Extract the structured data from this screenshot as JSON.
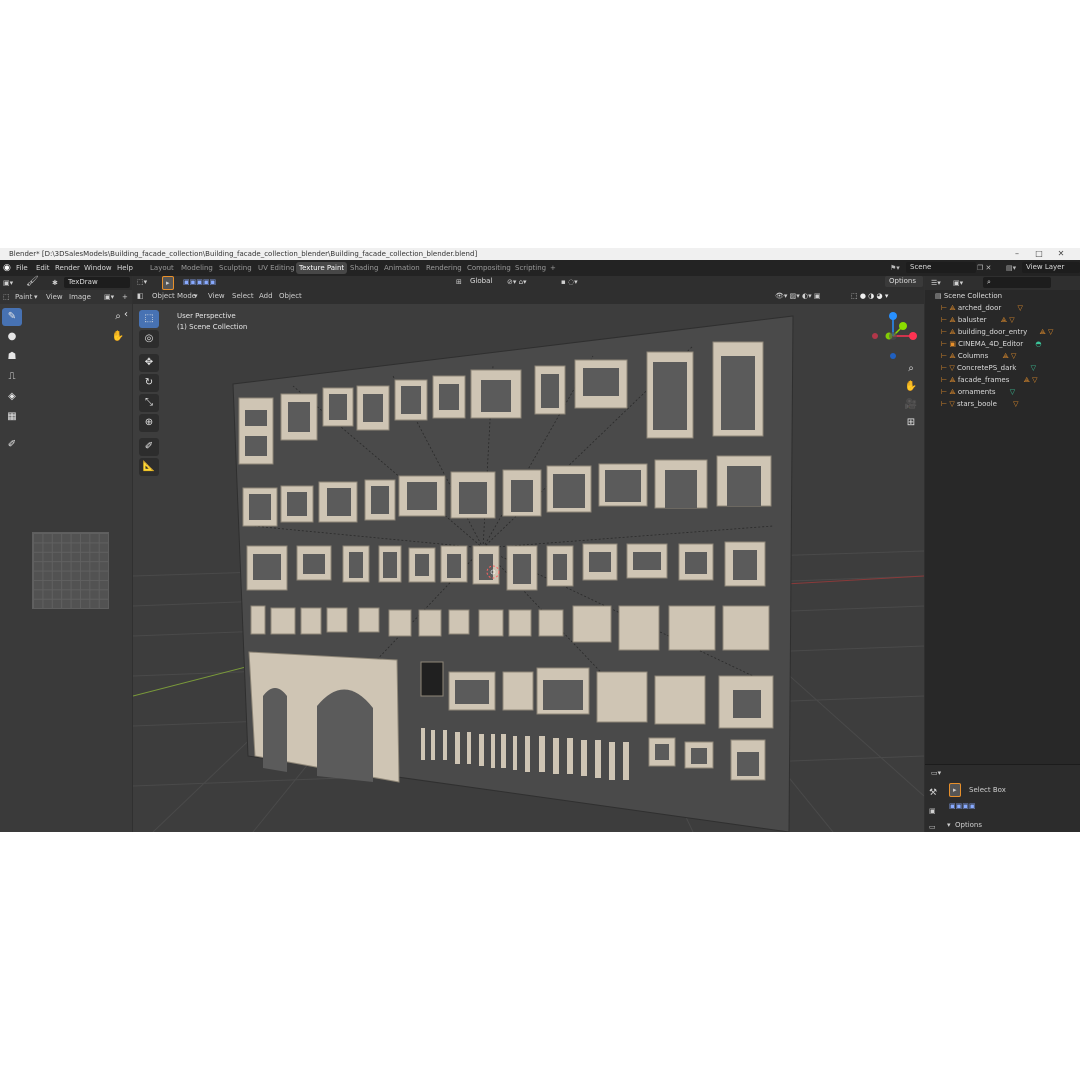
{
  "window": {
    "title": "Blender* [D:\\3DSalesModels\\Building_facade_collection\\Building_facade_collection_blender\\Building_facade_collection_blender.blend]",
    "minimize": "–",
    "maximize": "□",
    "close": "✕"
  },
  "menubar": {
    "items": [
      "File",
      "Edit",
      "Render",
      "Window",
      "Help"
    ],
    "workspaces": [
      "Layout",
      "Modeling",
      "Sculpting",
      "UV Editing",
      "Texture Paint",
      "Shading",
      "Animation",
      "Rendering",
      "Compositing",
      "Scripting"
    ],
    "active_workspace": "Texture Paint",
    "add_tab": "+",
    "scene_label": "Scene",
    "view_layer_label": "View Layer"
  },
  "image_editor": {
    "brush_name": "TexDraw",
    "mode_label": "Paint",
    "view_menu": "View",
    "image_menu": "Image"
  },
  "viewport": {
    "mode": "Object Mode",
    "menus": [
      "View",
      "Select",
      "Add",
      "Object"
    ],
    "transform_orientation": "Global",
    "options_label": "Options",
    "perspective_label": "User Perspective",
    "collection_label": "(1) Scene Collection",
    "gizmo_axes": {
      "x": "X",
      "y": "Y",
      "z": "Z"
    }
  },
  "outliner": {
    "root": "Scene Collection",
    "items": [
      {
        "name": "arched_door",
        "icon": "object-icon"
      },
      {
        "name": "baluster",
        "icon": "object-icon"
      },
      {
        "name": "building_door_entry",
        "icon": "object-icon"
      },
      {
        "name": "CINEMA_4D_Editor",
        "icon": "camera-icon"
      },
      {
        "name": "Columns",
        "icon": "object-icon"
      },
      {
        "name": "ConcretePS_dark",
        "icon": "mesh-icon"
      },
      {
        "name": "facade_frames",
        "icon": "object-icon"
      },
      {
        "name": "ornaments",
        "icon": "object-icon"
      },
      {
        "name": "stars_boole",
        "icon": "mesh-icon"
      }
    ]
  },
  "properties": {
    "tool_name": "Select Box",
    "options_label": "Options"
  },
  "colors": {
    "accent": "#4772b3",
    "outline_orange": "#e8902b",
    "axis_red": "#ff3352",
    "axis_green": "#8bdc00",
    "axis_blue": "#2890ff"
  }
}
